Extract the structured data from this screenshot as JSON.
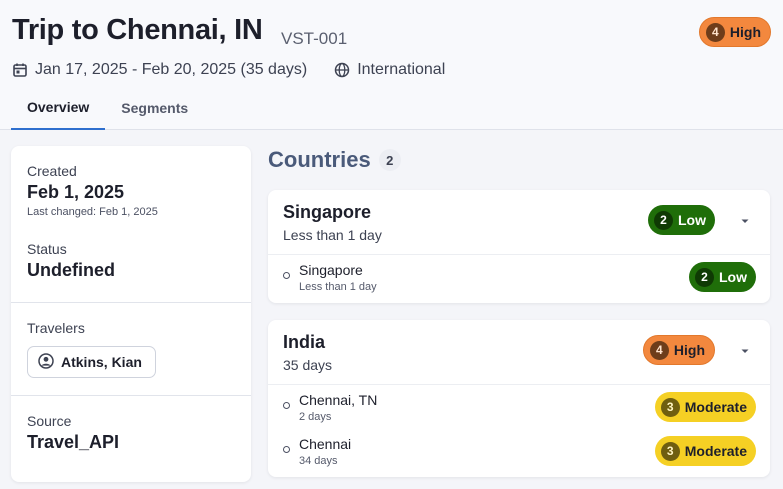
{
  "header": {
    "title": "Trip to Chennai, IN",
    "code": "VST-001",
    "risk": {
      "level": "4",
      "label": "High"
    },
    "dates": "Jan 17, 2025 - Feb 20, 2025 (35 days)",
    "scope": "International",
    "icons": {
      "dates": "calendar-icon",
      "scope": "globe-icon"
    }
  },
  "tabs": [
    {
      "label": "Overview",
      "active": true
    },
    {
      "label": "Segments",
      "active": false
    }
  ],
  "summary": {
    "created_label": "Created",
    "created_value": "Feb 1, 2025",
    "last_changed": "Last changed: Feb 1, 2025",
    "status_label": "Status",
    "status_value": "Undefined",
    "travelers_label": "Travelers",
    "traveler_name": "Atkins, Kian",
    "source_label": "Source",
    "source_value": "Travel_API"
  },
  "countries": {
    "title": "Countries",
    "count": "2",
    "items": [
      {
        "name": "Singapore",
        "duration": "Less than 1 day",
        "risk": {
          "level": "2",
          "label": "Low"
        },
        "cities": [
          {
            "name": "Singapore",
            "duration": "Less than 1 day",
            "risk": {
              "level": "2",
              "label": "Low"
            }
          }
        ]
      },
      {
        "name": "India",
        "duration": "35 days",
        "risk": {
          "level": "4",
          "label": "High"
        },
        "cities": [
          {
            "name": "Chennai, TN",
            "duration": "2 days",
            "risk": {
              "level": "3",
              "label": "Moderate"
            }
          },
          {
            "name": "Chennai",
            "duration": "34 days",
            "risk": {
              "level": "3",
              "label": "Moderate"
            }
          }
        ]
      }
    ]
  },
  "colors": {
    "high": "#f3883e",
    "low": "#1f6e09",
    "moderate": "#f5d024",
    "accent": "#2e6fce"
  }
}
